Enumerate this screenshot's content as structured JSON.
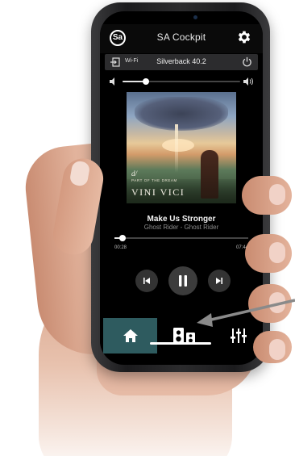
{
  "app": {
    "logo_text": "Sa",
    "title": "SA Cockpit",
    "icons": {
      "settings": "gear-icon",
      "exit": "exit-icon",
      "power": "power-icon"
    }
  },
  "connection": {
    "network": "Wi-Fi",
    "device": "Silverback 40.2"
  },
  "volume": {
    "level": 0.2
  },
  "album": {
    "mark": "d/",
    "subtitle": "PART OF THE DREAM",
    "artist_art_text": "VINI VICI"
  },
  "track": {
    "title": "Make Us Stronger",
    "subtitle": "Ghost Rider - Ghost Rider",
    "elapsed": "00:28",
    "total": "07:44",
    "progress": 0.06
  },
  "tabs": [
    {
      "name": "home",
      "icon": "home-icon",
      "active": true
    },
    {
      "name": "speakers",
      "icon": "speakers-icon",
      "active": false
    },
    {
      "name": "equalizer",
      "icon": "equalizer-icon",
      "active": false
    }
  ],
  "colors": {
    "active_tab": "#2e5b5f",
    "background": "#000000",
    "status_bar": "#2c2c2e"
  }
}
